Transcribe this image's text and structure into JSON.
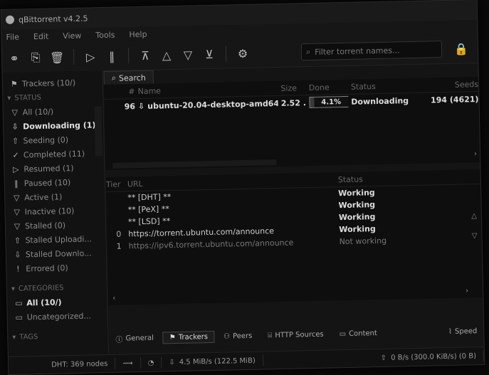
{
  "app": {
    "title": "qBittorrent v4.2.5"
  },
  "menu": [
    "File",
    "Edit",
    "View",
    "Tools",
    "Help"
  ],
  "toolbar": {
    "filter_placeholder": "Filter torrent names..."
  },
  "sidebar": {
    "trackers_header": "Trackers (10/)",
    "status_section": "STATUS",
    "status_items": [
      {
        "label": "All (10/)",
        "icon": "funnel-icon"
      },
      {
        "label": "Downloading (1)",
        "icon": "down-arrow-icon",
        "active": true
      },
      {
        "label": "Seeding (0)",
        "icon": "up-arrow-icon"
      },
      {
        "label": "Completed (11)",
        "icon": "check-icon"
      },
      {
        "label": "Resumed (1)",
        "icon": "play-icon"
      },
      {
        "label": "Paused (10)",
        "icon": "pause-icon"
      },
      {
        "label": "Active (1)",
        "icon": "funnel-icon"
      },
      {
        "label": "Inactive (10)",
        "icon": "funnel-icon"
      },
      {
        "label": "Stalled (0)",
        "icon": "funnel-icon"
      },
      {
        "label": "Stalled Uploadi...",
        "icon": "up-arrow-icon"
      },
      {
        "label": "Stalled Downlo...",
        "icon": "down-arrow-icon"
      },
      {
        "label": "Errored (0)",
        "icon": "error-icon"
      }
    ],
    "categories_section": "CATEGORIES",
    "category_items": [
      {
        "label": "All (10/)",
        "icon": "folder-icon",
        "active": true
      },
      {
        "label": "Uncategorized...",
        "icon": "folder-icon"
      }
    ],
    "tags_section": "TAGS"
  },
  "main": {
    "search_tab": "Search",
    "columns": [
      "#",
      "Name",
      "Size",
      "Done",
      "Status",
      "Seeds"
    ],
    "torrents": [
      {
        "num": "96",
        "name": "ubuntu-20.04-desktop-amd64.iso",
        "size": "2.52 ...",
        "done": "4.1%",
        "done_value": 0.041,
        "status": "Downloading",
        "seeds": "194 (4621)"
      }
    ]
  },
  "trackers": {
    "columns": [
      "Tier",
      "URL",
      "Status"
    ],
    "rows": [
      {
        "tier": "",
        "url": "** [DHT] **",
        "status": "Working",
        "muted": false
      },
      {
        "tier": "",
        "url": "** [PeX] **",
        "status": "Working",
        "muted": false
      },
      {
        "tier": "",
        "url": "** [LSD] **",
        "status": "Working",
        "muted": false
      },
      {
        "tier": "0",
        "url": "https://torrent.ubuntu.com/announce",
        "status": "Working",
        "muted": false
      },
      {
        "tier": "1",
        "url": "https://ipv6.torrent.ubuntu.com/announce",
        "status": "Not working",
        "muted": true
      }
    ]
  },
  "properties_tabs": [
    {
      "label": "General",
      "icon": "info-icon"
    },
    {
      "label": "Trackers",
      "icon": "trackers-icon",
      "active": true
    },
    {
      "label": "Peers",
      "icon": "peers-icon"
    },
    {
      "label": "HTTP Sources",
      "icon": "http-icon"
    },
    {
      "label": "Content",
      "icon": "folder-icon"
    },
    {
      "label": "Speed",
      "icon": "speed-icon"
    }
  ],
  "status": {
    "dht": "DHT: 369 nodes",
    "download": "4.5 MiB/s (122.5 MiB)",
    "upload": "0 B/s (300.0 KiB/s) (0 B)"
  }
}
